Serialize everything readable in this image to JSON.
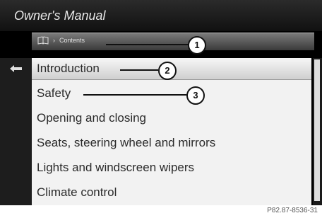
{
  "window": {
    "title": "Owner's Manual"
  },
  "breadcrumb": {
    "icon": "book-icon",
    "separator": "›",
    "label": "Contents"
  },
  "menu": {
    "items": [
      {
        "label": "Introduction",
        "selected": true
      },
      {
        "label": "Safety"
      },
      {
        "label": "Opening and closing"
      },
      {
        "label": "Seats, steering wheel and mirrors"
      },
      {
        "label": "Lights and windscreen wipers"
      },
      {
        "label": "Climate control"
      }
    ]
  },
  "callouts": [
    "1",
    "2",
    "3"
  ],
  "footer": {
    "code": "P82.87-8536-31"
  },
  "colors": {
    "selection": "#e6e6e6",
    "screen": "#000000",
    "list_bg": "#f2f2f2"
  }
}
